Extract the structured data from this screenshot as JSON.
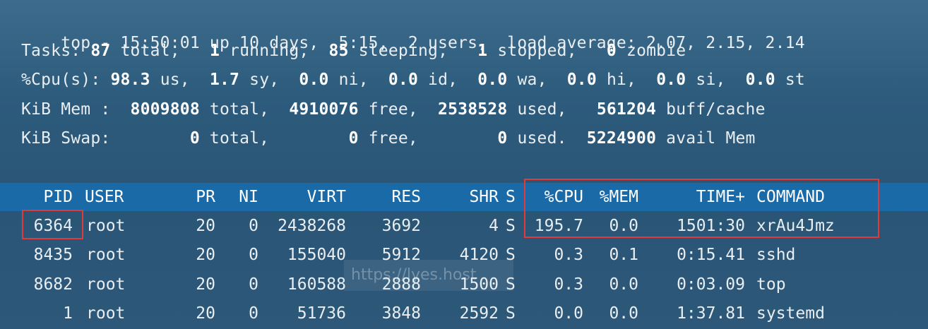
{
  "summary": {
    "line1": {
      "prefix": "top - 15:50:01 up 10 days,  5:15,  2 users,  load average: 2.07, 2.15, 2.14"
    },
    "tasks": {
      "label": "Tasks: ",
      "total": "87",
      "total_label": " total,   ",
      "running": "1",
      "running_label": " running,  ",
      "sleeping": "85",
      "sleeping_label": " sleeping,   ",
      "stopped": "1",
      "stopped_label": " stopped,   ",
      "zombie": "0",
      "zombie_label": " zombie"
    },
    "cpu": {
      "label": "%Cpu(s): ",
      "us": "98.3",
      "us_label": " us,  ",
      "sy": "1.7",
      "sy_label": " sy,  ",
      "ni": "0.0",
      "ni_label": " ni,  ",
      "id": "0.0",
      "id_label": " id,  ",
      "wa": "0.0",
      "wa_label": " wa,  ",
      "hi": "0.0",
      "hi_label": " hi,  ",
      "si": "0.0",
      "si_label": " si,  ",
      "st": "0.0",
      "st_label": " st"
    },
    "mem": {
      "label": "KiB Mem :  ",
      "total": "8009808",
      "total_label": " total,  ",
      "free": "4910076",
      "free_label": " free,  ",
      "used": "2538528",
      "used_label": " used,   ",
      "cache": "561204",
      "cache_label": " buff/cache"
    },
    "swap": {
      "label": "KiB Swap:        ",
      "total": "0",
      "total_label": " total,        ",
      "free": "0",
      "free_label": " free,        ",
      "used": "0",
      "used_label": " used.  ",
      "avail": "5224900",
      "avail_label": " avail Mem"
    }
  },
  "table": {
    "headers": {
      "pid": "PID",
      "user": "USER",
      "pr": "PR",
      "ni": "NI",
      "virt": "VIRT",
      "res": "RES",
      "shr": "SHR",
      "s": "S",
      "cpu": "%CPU",
      "mem": "%MEM",
      "time": "TIME+",
      "command": "COMMAND"
    },
    "rows": [
      {
        "pid": "6364",
        "user": "root",
        "pr": "20",
        "ni": "0",
        "virt": "2438268",
        "res": "3692",
        "shr": "4",
        "s": "S",
        "cpu": "195.7",
        "mem": "0.0",
        "time": "1501:30",
        "command": "xrAu4Jmz"
      },
      {
        "pid": "8435",
        "user": "root",
        "pr": "20",
        "ni": "0",
        "virt": "155040",
        "res": "5912",
        "shr": "4120",
        "s": "S",
        "cpu": "0.3",
        "mem": "0.1",
        "time": "0:15.41",
        "command": "sshd"
      },
      {
        "pid": "8682",
        "user": "root",
        "pr": "20",
        "ni": "0",
        "virt": "160588",
        "res": "2888",
        "shr": "1500",
        "s": "S",
        "cpu": "0.3",
        "mem": "0.0",
        "time": "0:03.09",
        "command": "top"
      },
      {
        "pid": "1",
        "user": "root",
        "pr": "20",
        "ni": "0",
        "virt": "51736",
        "res": "3848",
        "shr": "2592",
        "s": "S",
        "cpu": "0.0",
        "mem": "0.0",
        "time": "1:37.81",
        "command": "systemd"
      }
    ]
  },
  "watermark": "https://lyes.host",
  "colors": {
    "header_bar": "#1a6aa8",
    "highlight_box": "#e03a3a"
  }
}
